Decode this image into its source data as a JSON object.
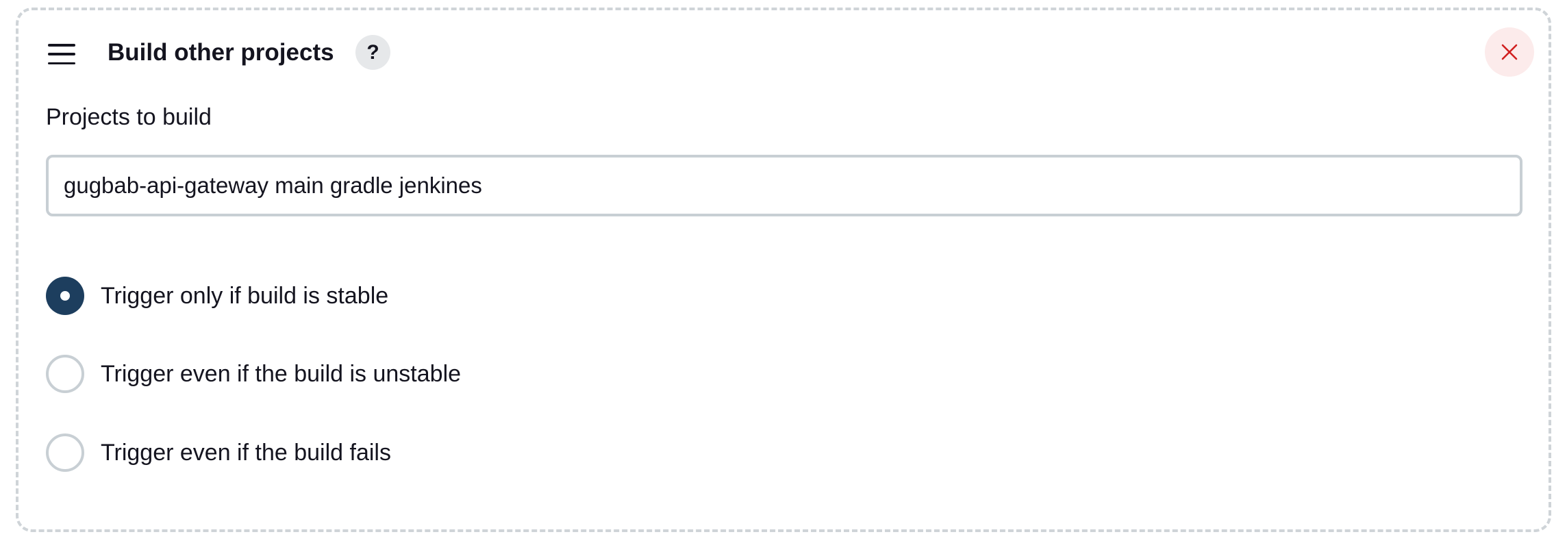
{
  "section": {
    "title": "Build other projects",
    "help_label": "?",
    "drag_icon": "hamburger-icon",
    "close_icon": "close-icon",
    "close_color": "#d11f1f"
  },
  "projects_field": {
    "label": "Projects to build",
    "value": "gugbab-api-gateway main gradle jenkines"
  },
  "trigger_options": [
    {
      "label": "Trigger only if build is stable",
      "selected": true
    },
    {
      "label": "Trigger even if the build is unstable",
      "selected": false
    },
    {
      "label": "Trigger even if the build fails",
      "selected": false
    }
  ],
  "colors": {
    "radio_selected": "#1d3e5e",
    "border": "#c8cfd4",
    "close_bg": "#fcebeb"
  }
}
